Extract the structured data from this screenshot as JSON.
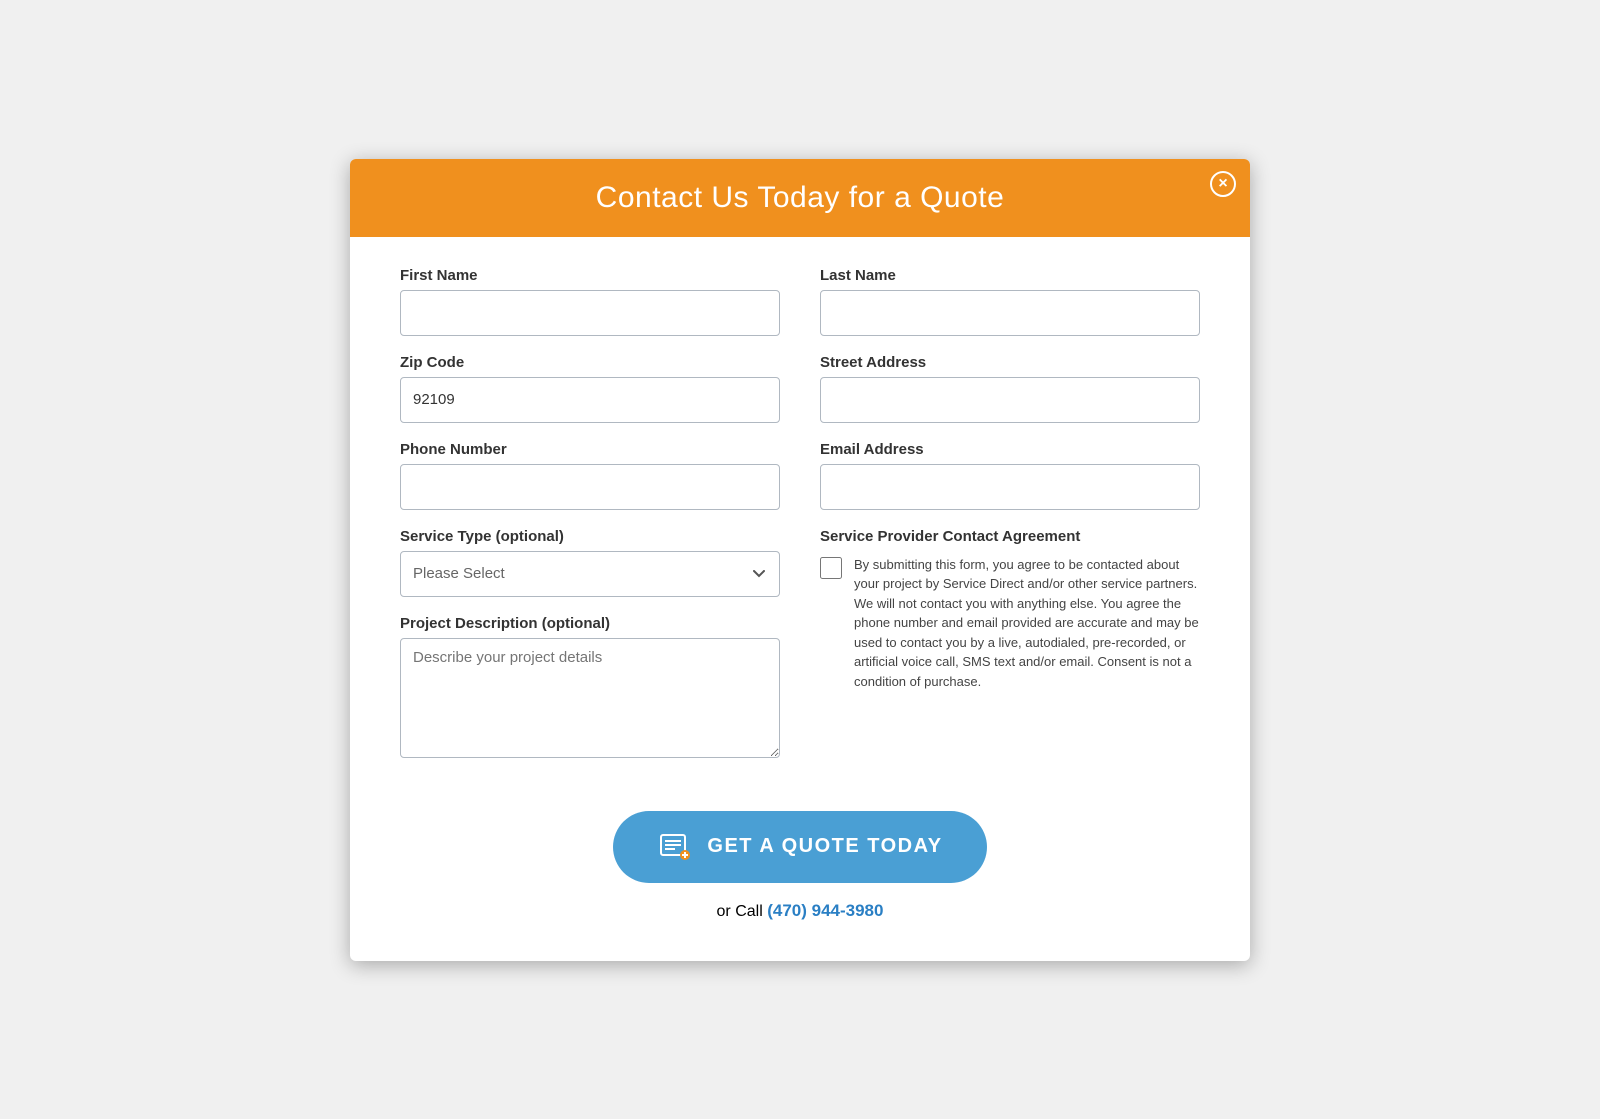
{
  "modal": {
    "title": "Contact Us Today for a Quote",
    "close_label": "×"
  },
  "form": {
    "first_name_label": "First Name",
    "first_name_placeholder": "",
    "last_name_label": "Last Name",
    "last_name_placeholder": "",
    "zip_code_label": "Zip Code",
    "zip_code_value": "92109",
    "street_address_label": "Street Address",
    "street_address_placeholder": "",
    "phone_number_label": "Phone Number",
    "phone_number_placeholder": "",
    "email_address_label": "Email Address",
    "email_address_placeholder": "",
    "service_type_label": "Service Type (optional)",
    "service_type_placeholder": "Please Select",
    "project_description_label": "Project Description (optional)",
    "project_description_placeholder": "Describe your project details",
    "agreement_title": "Service Provider Contact Agreement",
    "agreement_text": "By submitting this form, you agree to be contacted about your project by Service Direct and/or other service partners. We will not contact you with anything else. You agree the phone number and email provided are accurate and may be used to contact you by a live, autodialed, pre-recorded, or artificial voice call, SMS text and/or email. Consent is not a condition of purchase.",
    "submit_label": "GET A QUOTE TODAY",
    "or_call_text": "or Call",
    "phone_number_display": "(470) 944-3980",
    "phone_href": "tel:4709443980"
  }
}
